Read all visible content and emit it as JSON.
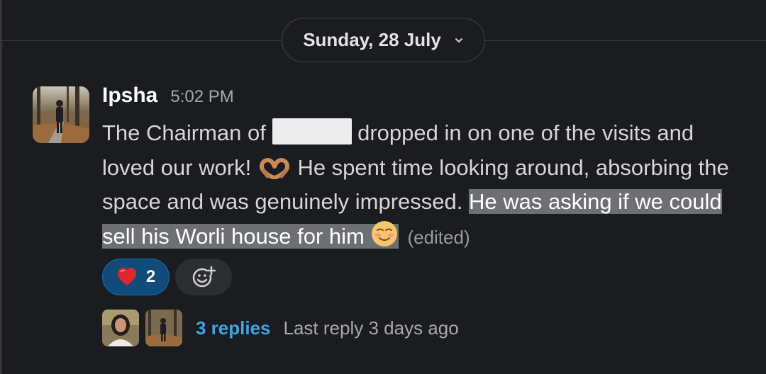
{
  "divider": {
    "date": "Sunday, 28 July"
  },
  "message": {
    "author": "Ipsha",
    "time": "5:02 PM",
    "text_1": "The Chairman of ",
    "text_2": " dropped in on one of the visits and loved our work! ",
    "text_3": " He spent time looking around, absorbing the space and was genuinely impressed. ",
    "text_highlighted": "He was asking if we could sell his Worli house for him ",
    "edited": "(edited)",
    "emoji_1": "heart-hands",
    "emoji_2": "smiling-face"
  },
  "reactions": [
    {
      "emoji": "red-heart",
      "count": "2",
      "active": true
    }
  ],
  "thread": {
    "replies": "3 replies",
    "last_reply": "Last reply 3 days ago"
  },
  "colors": {
    "background": "#1b1c1f",
    "link": "#3fa3e5",
    "reaction_active": "#104b7a",
    "highlight": "#6e6f73"
  }
}
